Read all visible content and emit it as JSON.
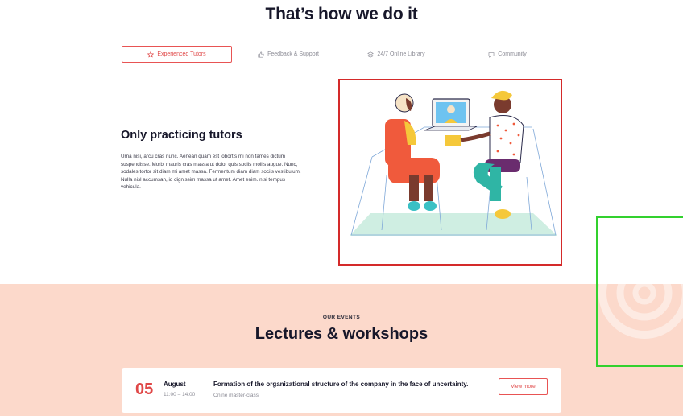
{
  "main_title": "That’s how we do it",
  "tabs": [
    {
      "label": "Experienced Tutors",
      "icon": "star-icon",
      "active": true
    },
    {
      "label": "Feedback & Support",
      "icon": "thumbs-up-icon",
      "active": false
    },
    {
      "label": "24/7 Online Library",
      "icon": "layers-icon",
      "active": false
    },
    {
      "label": "Community",
      "icon": "chat-icon",
      "active": false
    }
  ],
  "feature": {
    "heading": "Only practicing tutors",
    "body": "Urna nisi, arcu cras nunc. Aenean quam est lobortis mi non fames dictum suspendisse. Morbi mauris cras massa ut dolor quis sociis mollis augue. Nunc, sodales tortor sit diam mi amet massa. Fermentum diam diam sociis vestibulum. Nulla nisl accumsan, id dignissim massa ut amet. Amet enim. nisi tempus vehicula."
  },
  "events": {
    "eyebrow": "OUR EVENTS",
    "title": "Lectures & workshops",
    "items": [
      {
        "day": "05",
        "month": "August",
        "time": "11:00 – 14:00",
        "title": "Formation of the organizational structure of the company in the face of uncertainty.",
        "type": "Onine master-class",
        "button": "View more"
      }
    ]
  },
  "colors": {
    "accent": "#e04848",
    "band": "#fcd9cb",
    "illustration_frame": "#d42a2a",
    "highlight_frame": "#32d12e"
  }
}
